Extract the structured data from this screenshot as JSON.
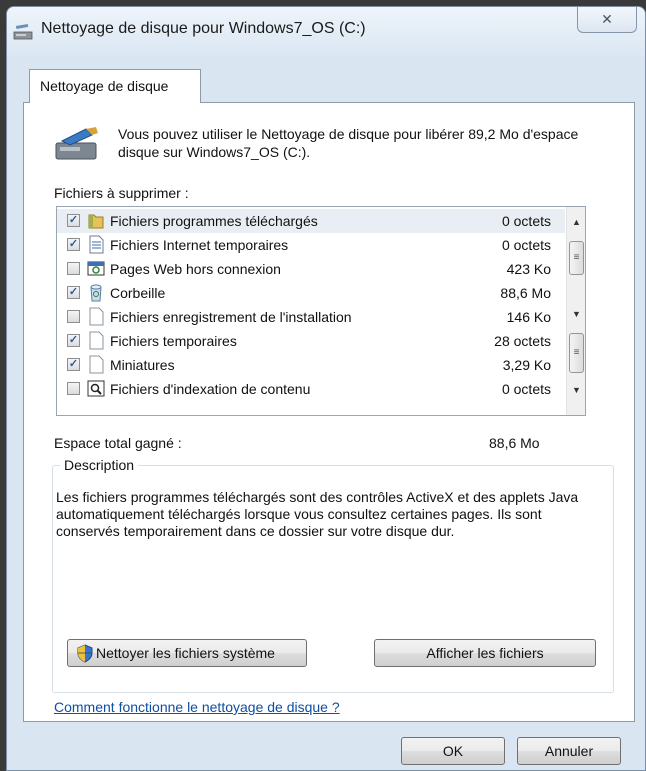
{
  "window": {
    "title": "Nettoyage de disque pour Windows7_OS (C:)",
    "close_label": "✕"
  },
  "tab": {
    "label": "Nettoyage de disque"
  },
  "intro": {
    "text": "Vous pouvez utiliser le Nettoyage de disque pour libérer 89,2 Mo d'espace disque sur Windows7_OS (C:)."
  },
  "files_label": "Fichiers à supprimer :",
  "files": [
    {
      "name": "Fichiers programmes téléchargés",
      "size": "0 octets",
      "checked": true,
      "icon": "folder-icon"
    },
    {
      "name": "Fichiers Internet temporaires",
      "size": "0 octets",
      "checked": true,
      "icon": "document-icon"
    },
    {
      "name": "Pages Web hors connexion",
      "size": "423 Ko",
      "checked": false,
      "icon": "offline-pages-icon"
    },
    {
      "name": "Corbeille",
      "size": "88,6 Mo",
      "checked": true,
      "icon": "recycle-bin-icon"
    },
    {
      "name": "Fichiers enregistrement de l'installation",
      "size": "146 Ko",
      "checked": false,
      "icon": "blank-file-icon"
    },
    {
      "name": "Fichiers temporaires",
      "size": "28 octets",
      "checked": true,
      "icon": "blank-file-icon"
    },
    {
      "name": "Miniatures",
      "size": "3,29 Ko",
      "checked": true,
      "icon": "blank-file-icon"
    },
    {
      "name": "Fichiers d'indexation de contenu",
      "size": "0 octets",
      "checked": false,
      "icon": "search-file-icon"
    }
  ],
  "total": {
    "label": "Espace total gagné :",
    "value": "88,6 Mo"
  },
  "description": {
    "legend": "Description",
    "text": "Les fichiers programmes téléchargés sont des contrôles ActiveX et des applets Java automatiquement téléchargés lorsque vous consultez certaines pages. Ils sont conservés temporairement dans ce dossier sur votre disque dur."
  },
  "buttons": {
    "clean_system": "Nettoyer les fichiers système",
    "view_files": "Afficher les fichiers",
    "ok": "OK",
    "cancel": "Annuler"
  },
  "help_link": "Comment fonctionne le nettoyage de disque ?"
}
